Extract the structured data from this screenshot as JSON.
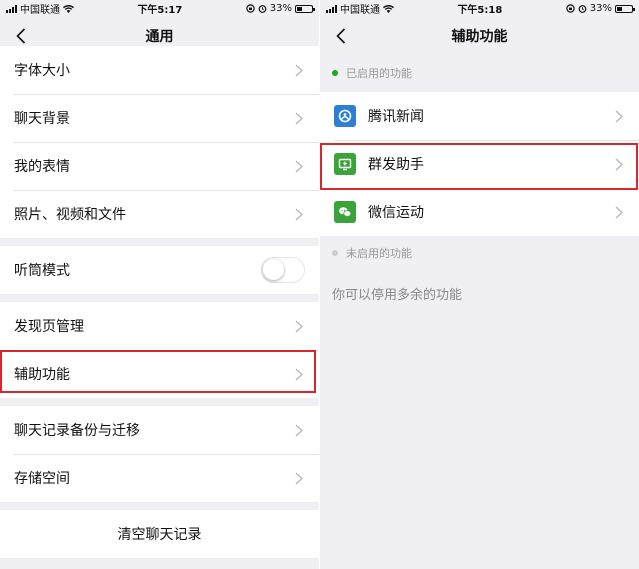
{
  "status_left": {
    "carrier": "中国联通",
    "time": "下午5:17",
    "battery": "33%",
    "battery_level": 0.33
  },
  "status_right": {
    "carrier": "中国联通",
    "time": "下午5:18",
    "battery": "33%",
    "battery_level": 0.33
  },
  "general": {
    "title": "通用",
    "group1": [
      {
        "label": "字体大小"
      },
      {
        "label": "聊天背景"
      },
      {
        "label": "我的表情"
      },
      {
        "label": "照片、视频和文件"
      }
    ],
    "earpiece": {
      "label": "听筒模式",
      "enabled": false
    },
    "group3": [
      {
        "label": "发现页管理"
      },
      {
        "label": "辅助功能"
      }
    ],
    "group4": [
      {
        "label": "聊天记录备份与迁移"
      },
      {
        "label": "存储空间"
      }
    ],
    "clear_history": "清空聊天记录"
  },
  "accessibility": {
    "title": "辅助功能",
    "enabled_section": "已启用的功能",
    "enabled_items": [
      {
        "label": "腾讯新闻",
        "icon": "tencent-news-icon"
      },
      {
        "label": "群发助手",
        "icon": "mass-message-icon"
      },
      {
        "label": "微信运动",
        "icon": "wechat-sports-icon"
      }
    ],
    "disabled_section": "未启用的功能",
    "tip": "你可以停用多余的功能"
  },
  "colors": {
    "highlight": "#d9272e",
    "enabled_dot": "#1aad19",
    "disabled_dot": "#cccccc",
    "news_icon_bg": "#2d7fd6",
    "mass_icon_bg": "#3aa33a",
    "sports_icon_bg": "#3aa33a"
  }
}
